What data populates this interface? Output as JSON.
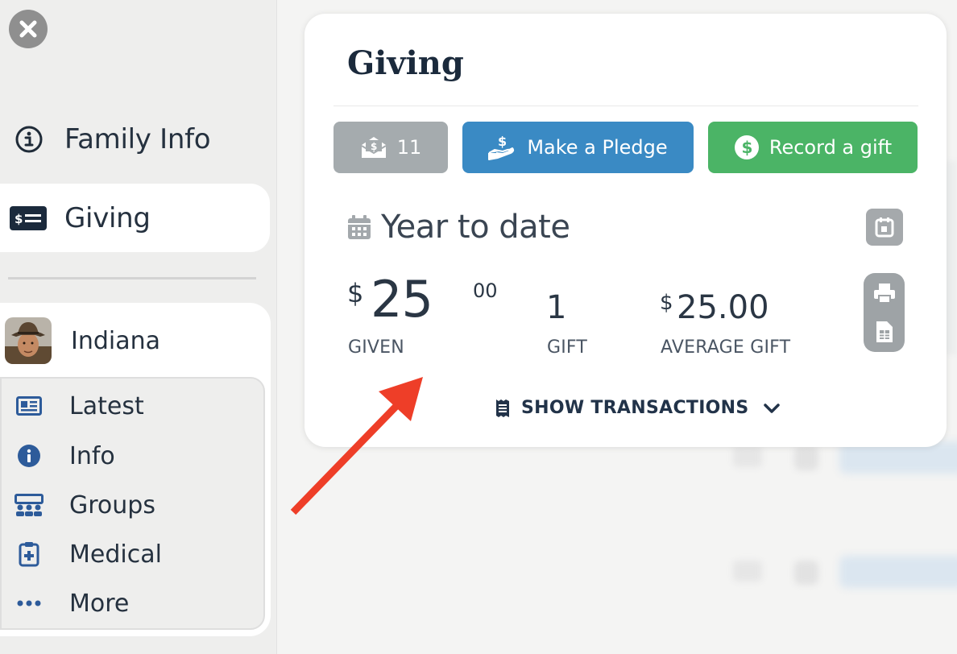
{
  "sidebar": {
    "close_label": "Close",
    "nav": {
      "family_info": "Family Info",
      "giving": "Giving"
    },
    "person": {
      "name": "Indiana",
      "menu": [
        {
          "label": "Latest",
          "icon": "newspaper-icon"
        },
        {
          "label": "Info",
          "icon": "info-circle-icon"
        },
        {
          "label": "Groups",
          "icon": "groups-icon"
        },
        {
          "label": "Medical",
          "icon": "medical-clipboard-icon"
        },
        {
          "label": "More",
          "icon": "more-dots-icon"
        }
      ]
    }
  },
  "giving_panel": {
    "title": "Giving",
    "buttons": {
      "envelope_count": "11",
      "pledge": "Make a Pledge",
      "record_gift": "Record a gift"
    },
    "period_title": "Year to date",
    "stats": {
      "given_currency": "$",
      "given_amount": "25",
      "given_cents": "00",
      "given_label": "GIVEN",
      "gift_count": "1",
      "gift_label": "GIFT",
      "average_currency": "$",
      "average_amount": "25.00",
      "average_label": "AVERAGE GIFT"
    },
    "show_transactions": "SHOW TRANSACTIONS"
  },
  "colors": {
    "navy": "#1b2a3c",
    "count_button": "#a5abae",
    "pledge_button": "#3a8ac4",
    "gift_button": "#4bb466",
    "annotation_arrow": "#ee3e28",
    "icon_blue": "#2d5b9a"
  }
}
